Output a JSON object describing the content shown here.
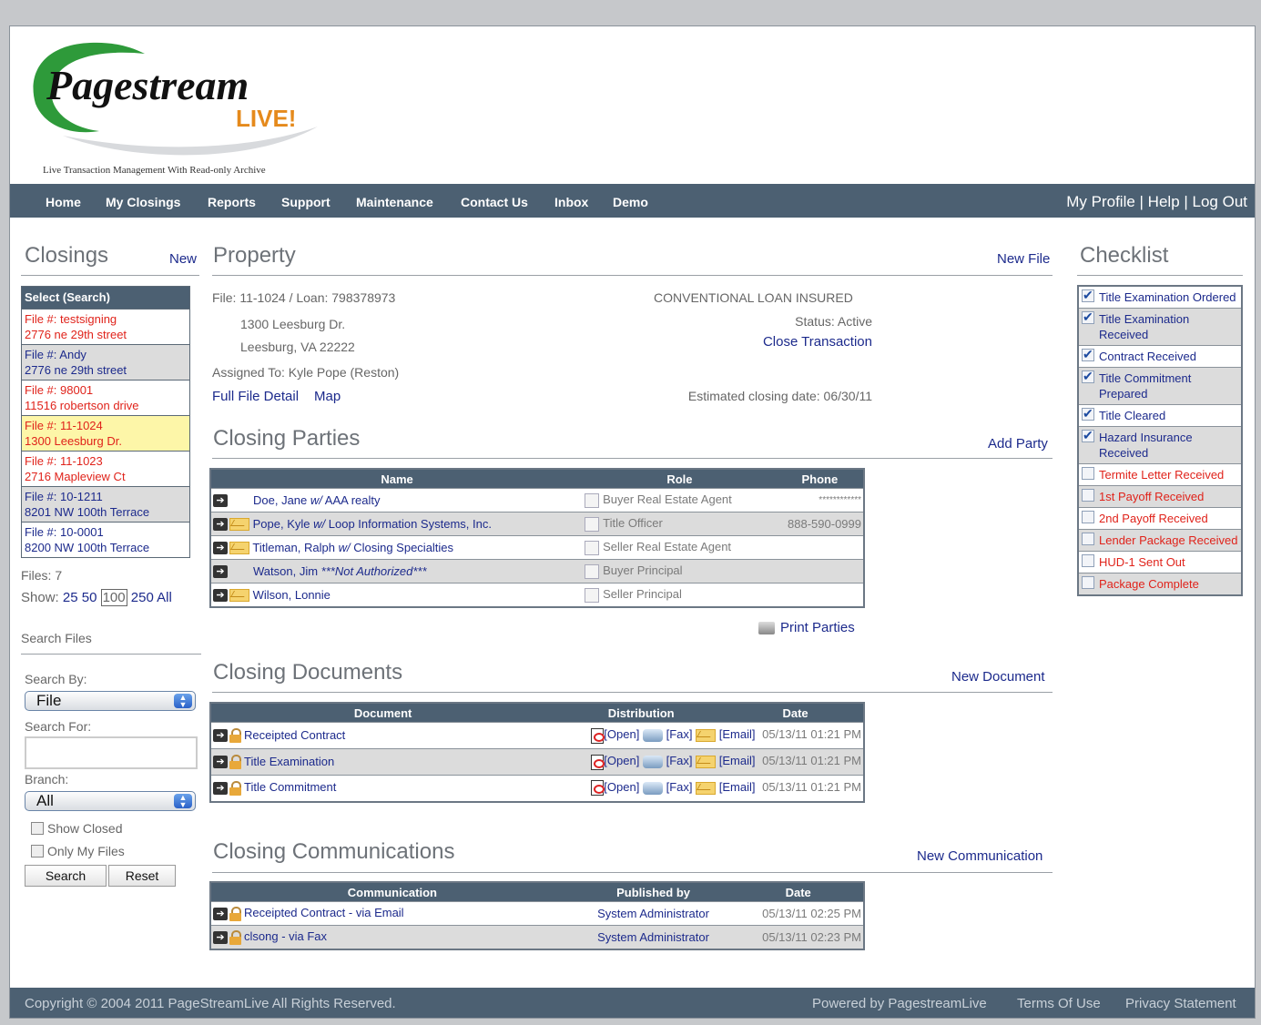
{
  "brand": {
    "logo_main": "Pagestream",
    "logo_sub": "LIVE!",
    "tagline": "Live Transaction Management With Read-only Archive"
  },
  "nav": {
    "items": [
      "Home",
      "My Closings",
      "Reports",
      "Support",
      "Maintenance",
      "Contact Us",
      "Inbox",
      "Demo"
    ],
    "right": "My Profile | Help | Log Out"
  },
  "sidebar": {
    "title": "Closings",
    "new_link": "New",
    "list_header": "Select  (Search)",
    "files": [
      {
        "num": "File #: testsigning",
        "addr": "2776 ne 29th street"
      },
      {
        "num": "File #: Andy",
        "addr": "2776 ne 29th street"
      },
      {
        "num": "File #: 98001",
        "addr": "11516 robertson drive"
      },
      {
        "num": "File #: 11-1024",
        "addr": "1300 Leesburg Dr."
      },
      {
        "num": "File #: 11-1023",
        "addr": "2716 Mapleview Ct"
      },
      {
        "num": "File #: 10-1211",
        "addr": "8201 NW 100th Terrace"
      },
      {
        "num": "File #: 10-0001",
        "addr": "8200 NW 100th Terrace"
      }
    ],
    "files_count": "Files: 7",
    "show_label": "Show:",
    "show_opts": [
      "25",
      "50",
      "100",
      "250",
      "All"
    ],
    "search_title": "Search Files",
    "search_by_label": "Search By:",
    "search_by_value": "File",
    "search_for_label": "Search For:",
    "branch_label": "Branch:",
    "branch_value": "All",
    "show_closed": "Show Closed",
    "only_my": "Only My Files",
    "search_btn": "Search",
    "reset_btn": "Reset"
  },
  "property": {
    "title": "Property",
    "new_file": "New File",
    "file_loan": "File: 11-1024 / Loan: 798378973",
    "loan_type": "CONVENTIONAL LOAN INSURED",
    "addr1": "1300 Leesburg Dr.",
    "addr2": "Leesburg, VA 22222",
    "status": "Status: Active",
    "close_tx": "Close Transaction",
    "assigned": "Assigned To: Kyle Pope (Reston)",
    "full_detail": "Full File Detail",
    "map": "Map",
    "est_close": "Estimated closing date: 06/30/11"
  },
  "parties": {
    "title": "Closing Parties",
    "add": "Add Party",
    "headers": [
      "Name",
      "Role",
      "Phone"
    ],
    "rows": [
      {
        "name": "Doe, Jane",
        "w": "w/",
        "co": "AAA realty",
        "role": "Buyer Real Estate Agent",
        "phone": "************",
        "env": false
      },
      {
        "name": "Pope, Kyle",
        "w": "w/",
        "co": "Loop Information Systems, Inc.",
        "role": "Title Officer",
        "phone": "888-590-0999",
        "env": true
      },
      {
        "name": "Titleman, Ralph",
        "w": "w/",
        "co": "Closing Specialties",
        "role": "Seller Real Estate Agent",
        "phone": "",
        "env": true
      },
      {
        "name": "Watson, Jim",
        "w": "***Not Authorized***",
        "co": "",
        "role": "Buyer Principal",
        "phone": "",
        "env": false
      },
      {
        "name": "Wilson, Lonnie",
        "w": "",
        "co": "",
        "role": "Seller Principal",
        "phone": "",
        "env": true
      }
    ],
    "print": "Print Parties"
  },
  "documents": {
    "title": "Closing Documents",
    "new": "New Document",
    "headers": [
      "Document",
      "Distribution",
      "Date"
    ],
    "rows": [
      {
        "name": "Receipted Contract",
        "date": "05/13/11 01:21 PM"
      },
      {
        "name": "Title Examination",
        "date": "05/13/11 01:21 PM"
      },
      {
        "name": "Title Commitment",
        "date": "05/13/11 01:21 PM"
      }
    ],
    "open": "[Open]",
    "fax": "[Fax]",
    "email": "[Email]"
  },
  "communications": {
    "title": "Closing Communications",
    "new": "New Communication",
    "headers": [
      "Communication",
      "Published by",
      "Date"
    ],
    "rows": [
      {
        "name": "Receipted Contract - via Email",
        "by": "System Administrator",
        "date": "05/13/11 02:25 PM"
      },
      {
        "name": "clsong - via Fax",
        "by": "System Administrator",
        "date": "05/13/11 02:23 PM"
      }
    ]
  },
  "checklist": {
    "title": "Checklist",
    "items": [
      {
        "label": "Title Examination Ordered",
        "done": true
      },
      {
        "label": "Title Examination Received",
        "done": true
      },
      {
        "label": "Contract Received",
        "done": true
      },
      {
        "label": "Title Commitment Prepared",
        "done": true
      },
      {
        "label": "Title Cleared",
        "done": true
      },
      {
        "label": "Hazard Insurance Received",
        "done": true
      },
      {
        "label": "Termite Letter Received",
        "done": false
      },
      {
        "label": "1st Payoff Received",
        "done": false
      },
      {
        "label": "2nd Payoff Received",
        "done": false
      },
      {
        "label": "Lender Package Received",
        "done": false
      },
      {
        "label": "HUD-1 Sent Out",
        "done": false
      },
      {
        "label": "Package Complete",
        "done": false
      }
    ]
  },
  "footer": {
    "copyright": "Copyright © 2004 2011 PageStreamLive All Rights Reserved.",
    "powered": "Powered by PagestreamLive",
    "terms": "Terms Of Use",
    "privacy": "Privacy Statement"
  },
  "colors": {
    "nav": "#4c6072",
    "link": "#1c2a8c",
    "alert": "#e0231b",
    "highlight": "#fdf6a8"
  }
}
